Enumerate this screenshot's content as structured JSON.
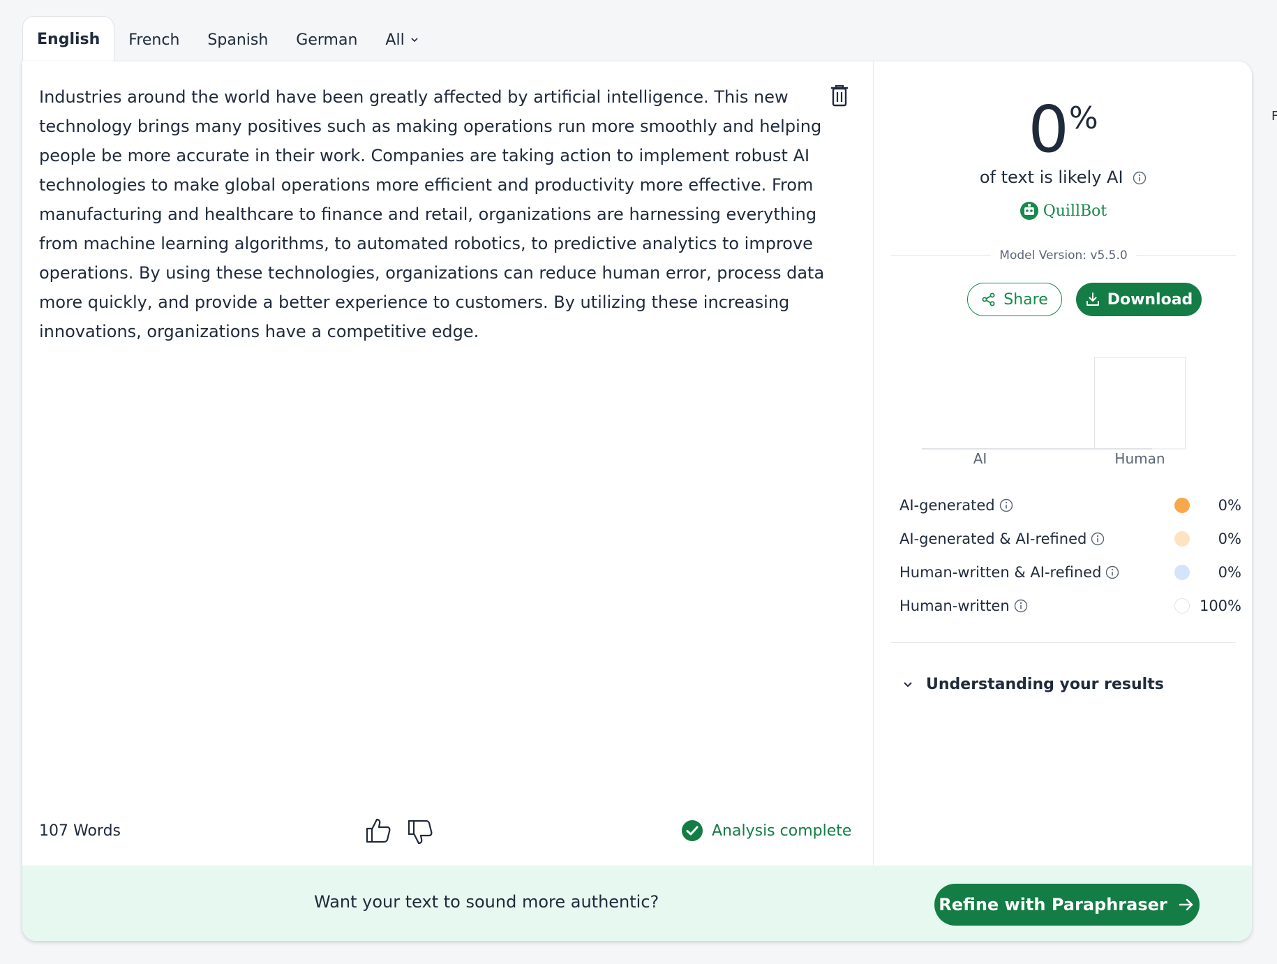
{
  "tabs": [
    {
      "label": "English",
      "active": true
    },
    {
      "label": "French",
      "active": false
    },
    {
      "label": "Spanish",
      "active": false
    },
    {
      "label": "German",
      "active": false
    },
    {
      "label": "All",
      "active": false
    }
  ],
  "editor": {
    "text": "Industries around the world have been greatly affected by artificial intelligence. This new technology brings many positives such as making operations run more smoothly and helping people be more accurate in their work. Companies are taking action to implement robust AI technologies to make global operations more efficient and productivity more effective. From manufacturing and healthcare to finance and retail, organizations are harnessing everything from machine learning algorithms, to automated robotics, to predictive analytics to improve operations. By using these technologies, organizations can reduce human error, process data more quickly, and provide a better experience to customers. By utilizing these increasing innovations, organizations have a competitive edge.",
    "word_count": "107 Words",
    "status": "Analysis complete"
  },
  "results": {
    "score": "0",
    "score_unit": "%",
    "score_caption": "of text is likely AI",
    "brand": "QuillBot",
    "model_version": "Model Version: v5.5.0",
    "share_label": "Share",
    "download_label": "Download",
    "understanding_label": "Understanding your results"
  },
  "chart_data": {
    "type": "bar",
    "categories": [
      "AI",
      "Human"
    ],
    "values": [
      0,
      100
    ],
    "ylim": [
      0,
      100
    ],
    "grid": false
  },
  "legend": [
    {
      "label": "AI-generated",
      "value": "0%",
      "color": "#f8a84a"
    },
    {
      "label": "AI-generated & AI-refined",
      "value": "0%",
      "color": "#fde3c2"
    },
    {
      "label": "Human-written & AI-refined",
      "value": "0%",
      "color": "#d5e4fb"
    },
    {
      "label": "Human-written",
      "value": "100%",
      "color": "#ffffff"
    }
  ],
  "cta": {
    "text": "Want your text to sound more authentic?",
    "button_label": "Refine with Paraphraser"
  },
  "edge_text": "F",
  "colors": {
    "accent": "#137d45",
    "cta_bg": "#e6f8ef"
  }
}
